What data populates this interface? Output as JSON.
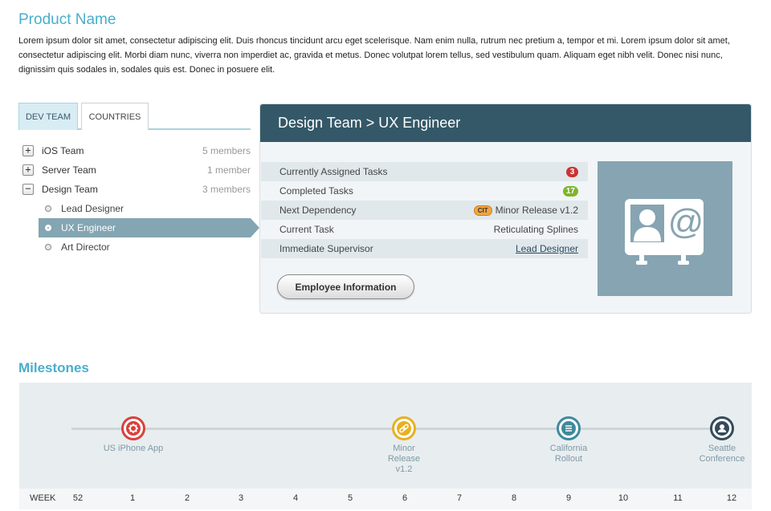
{
  "header": {
    "title": "Product Name",
    "description": "Lorem ipsum dolor sit amet, consectetur adipiscing elit. Duis rhoncus tincidunt arcu eget scelerisque. Nam enim nulla, rutrum nec pretium a, tempor et mi. Lorem ipsum dolor sit amet, consectetur adipiscing elit. Morbi diam nunc, viverra non imperdiet ac, gravida et metus. Donec volutpat lorem tellus, sed vestibulum quam. Aliquam eget nibh velit. Donec nisi nunc, dignissim quis sodales in, sodales quis est. Donec in posuere elit."
  },
  "tabs": [
    {
      "label": "DEV TEAM",
      "active": true
    },
    {
      "label": "COUNTRIES",
      "active": false
    }
  ],
  "tree": {
    "teams": [
      {
        "label": "iOS Team",
        "count": "5 members",
        "toggle": "+"
      },
      {
        "label": "Server Team",
        "count": "1 member",
        "toggle": "+"
      },
      {
        "label": "Design Team",
        "count": "3 members",
        "toggle": "−"
      }
    ],
    "design_children": [
      {
        "label": "Lead Designer"
      },
      {
        "label": "UX Engineer",
        "selected": true
      },
      {
        "label": "Art Director"
      }
    ]
  },
  "panel": {
    "title": "Design Team > UX Engineer",
    "rows": {
      "assigned": {
        "label": "Currently Assigned Tasks",
        "value": "3"
      },
      "completed": {
        "label": "Completed Tasks",
        "value": "17"
      },
      "dependency": {
        "label": "Next Dependency",
        "tag": "CIT",
        "value": "Minor Release v1.2"
      },
      "current": {
        "label": "Current Task",
        "value": "Reticulating Splines"
      },
      "supervisor": {
        "label": "Immediate Supervisor",
        "value": "Lead Designer"
      }
    },
    "button_label": "Employee Information",
    "card_icon": "contact-card-icon"
  },
  "milestones": {
    "title": "Milestones",
    "items": [
      {
        "label": "US iPhone App",
        "color": "#d9403a",
        "icon": "gear-icon"
      },
      {
        "label": "Minor Release v1.2",
        "line1": "Minor",
        "line2": "Release",
        "line3": "v1.2",
        "color": "#e8b020",
        "icon": "link-icon"
      },
      {
        "label": "California Rollout",
        "line1": "California",
        "line2": "Rollout",
        "color": "#3f8a9c",
        "icon": "stack-icon"
      },
      {
        "label": "Seattle Conference",
        "line1": "Seattle",
        "line2": "Conference",
        "color": "#354b5a",
        "icon": "person-icon"
      }
    ],
    "week_label": "WEEK",
    "weeks": [
      "52",
      "1",
      "2",
      "3",
      "4",
      "5",
      "6",
      "7",
      "8",
      "9",
      "10",
      "11",
      "12"
    ]
  },
  "colors": {
    "accent": "#4aaecc",
    "panel_header": "#345868",
    "selection": "#84a5b2"
  }
}
